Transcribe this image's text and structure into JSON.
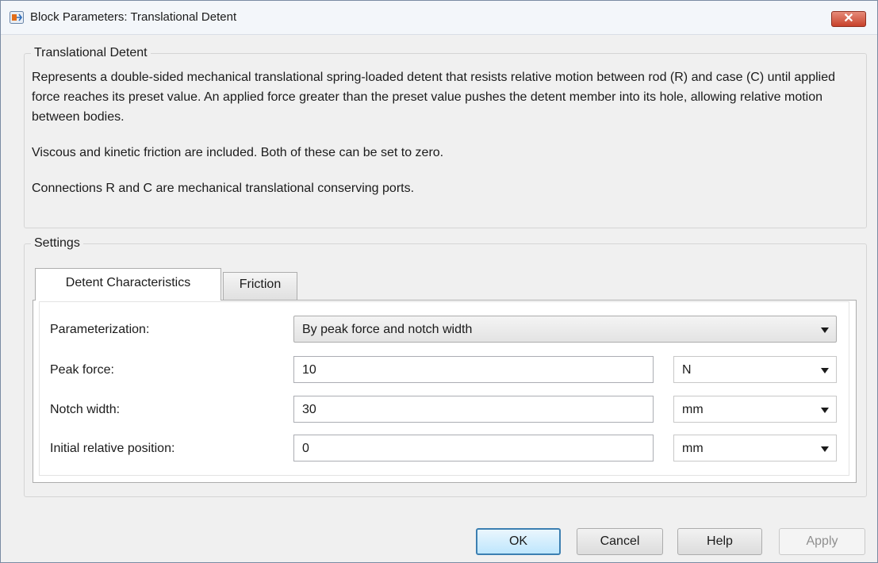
{
  "window": {
    "title": "Block Parameters: Translational Detent"
  },
  "description_group": {
    "legend": "Translational Detent",
    "paragraphs": [
      "Represents a double-sided mechanical translational spring-loaded detent that resists relative motion between rod (R) and case (C) until applied force reaches its preset value. An applied force greater than the preset value pushes the detent member into its hole, allowing relative motion between bodies.",
      "Viscous and kinetic friction are included.  Both of these can be set to zero.",
      "Connections R and C are mechanical translational conserving ports."
    ]
  },
  "settings": {
    "legend": "Settings",
    "tabs": [
      {
        "label": "Detent Characteristics",
        "active": true
      },
      {
        "label": "Friction",
        "active": false
      }
    ],
    "parameterization": {
      "label": "Parameterization:",
      "value": "By peak force and notch width"
    },
    "rows": [
      {
        "label": "Peak force:",
        "value": "10",
        "unit": "N"
      },
      {
        "label": "Notch width:",
        "value": "30",
        "unit": "mm"
      },
      {
        "label": "Initial relative position:",
        "value": "0",
        "unit": "mm"
      }
    ]
  },
  "buttons": {
    "ok": "OK",
    "cancel": "Cancel",
    "help": "Help",
    "apply": "Apply"
  },
  "colors": {
    "accent": "#3c7fb1",
    "close": "#c7412b"
  }
}
